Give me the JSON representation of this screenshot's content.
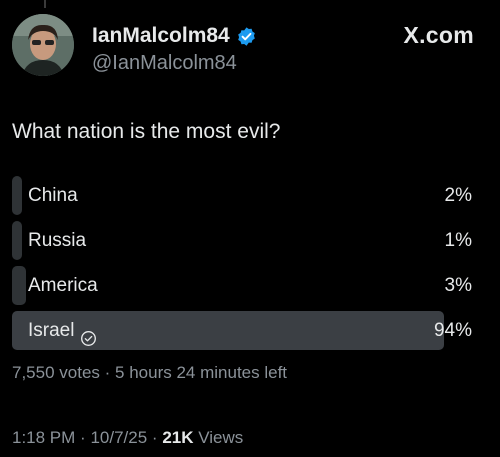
{
  "post": {
    "display_name": "IanMalcolm84",
    "handle": "@IanMalcolm84",
    "site": "X.com",
    "question": "What nation is the most evil?"
  },
  "poll": {
    "options": [
      {
        "label": "China",
        "percent_text": "2%",
        "percent": 2,
        "winner": false
      },
      {
        "label": "Russia",
        "percent_text": "1%",
        "percent": 1,
        "winner": false
      },
      {
        "label": "America",
        "percent_text": "3%",
        "percent": 3,
        "winner": false
      },
      {
        "label": "Israel",
        "percent_text": "94%",
        "percent": 94,
        "winner": true
      }
    ],
    "votes": "7,550 votes",
    "separator": "·",
    "time_left": "5 hours 24 minutes left"
  },
  "footer": {
    "time": "1:18 PM",
    "date": "10/7/25",
    "separator": "·",
    "views_count": "21K",
    "views_label": "Views"
  },
  "icons": {
    "verified": "verified-badge-icon",
    "winner": "check-circle-icon"
  },
  "colors": {
    "background": "#000000",
    "text": "#e7e9ea",
    "secondary_text": "#8b9299",
    "bar": "#3b3f44",
    "verified": "#1d9bf0"
  }
}
